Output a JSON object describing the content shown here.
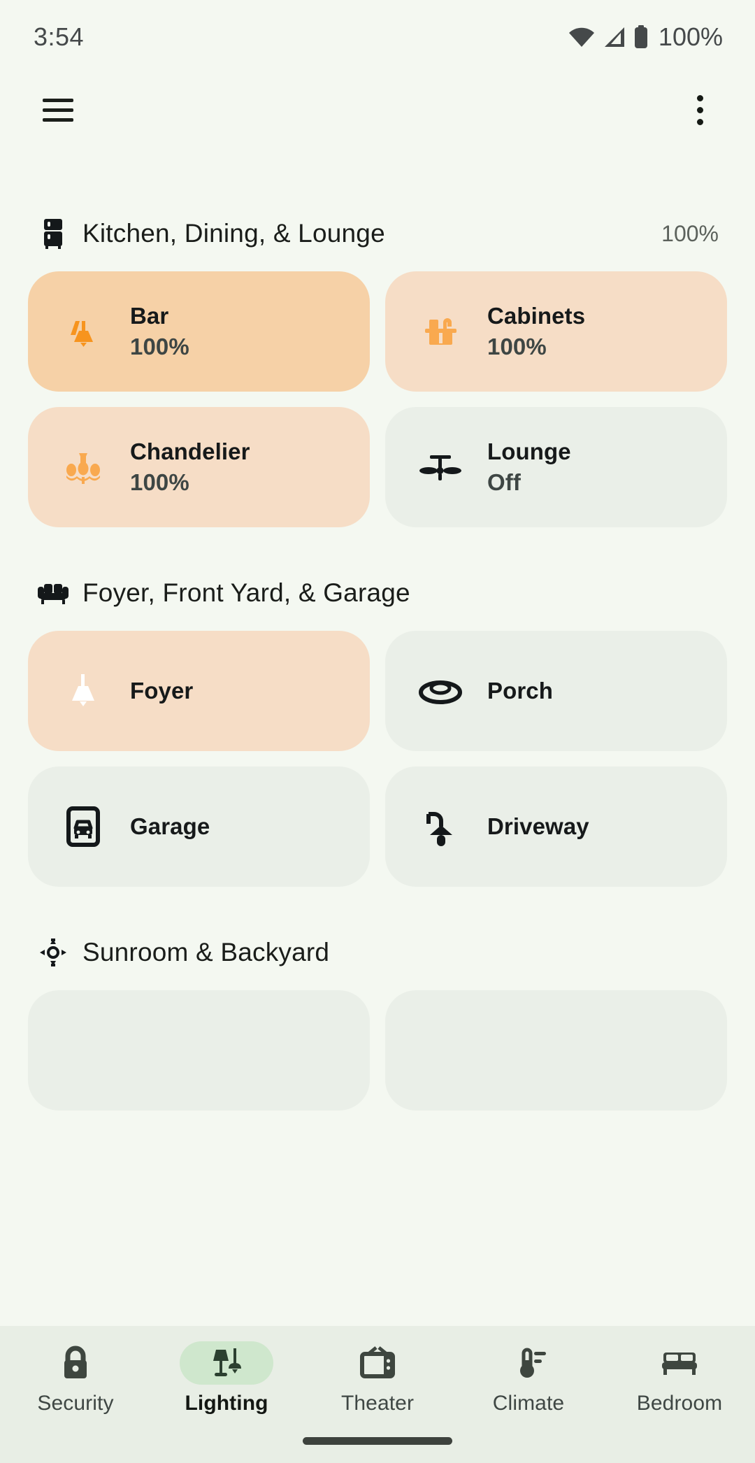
{
  "status_bar": {
    "time": "3:54",
    "battery_percent": "100%",
    "icons": [
      "wifi-icon",
      "cellular-signal-icon",
      "battery-icon"
    ]
  },
  "app_bar": {
    "menu_label": "menu-icon",
    "overflow_label": "more-options-icon"
  },
  "sections": [
    {
      "id": "kitchen-dining-lounge",
      "icon": "refrigerator-icon",
      "title": "Kitchen, Dining, & Lounge",
      "percent": "100%",
      "tiles": [
        {
          "name": "Bar",
          "state": "100%",
          "icon": "wall-lamp-icon",
          "status": "on-strong"
        },
        {
          "name": "Cabinets",
          "state": "100%",
          "icon": "kitchen-sink-icon",
          "status": "on-soft"
        },
        {
          "name": "Chandelier",
          "state": "100%",
          "icon": "chandelier-icon",
          "status": "on-soft"
        },
        {
          "name": "Lounge",
          "state": "Off",
          "icon": "ceiling-fan-icon",
          "status": "off"
        }
      ]
    },
    {
      "id": "foyer-front-yard-garage",
      "icon": "sofa-icon",
      "title": "Foyer, Front Yard, & Garage",
      "percent": "",
      "tiles": [
        {
          "name": "Foyer",
          "state": "",
          "icon": "pendant-lamp-icon",
          "status": "on-soft-white"
        },
        {
          "name": "Porch",
          "state": "",
          "icon": "dome-light-icon",
          "status": "off"
        },
        {
          "name": "Garage",
          "state": "",
          "icon": "garage-car-icon",
          "status": "off"
        },
        {
          "name": "Driveway",
          "state": "",
          "icon": "outdoor-lamp-icon",
          "status": "off"
        }
      ]
    },
    {
      "id": "sunroom-backyard",
      "icon": "sun-brightness-icon",
      "title": "Sunroom & Backyard",
      "percent": "",
      "tiles": [
        {
          "name": "",
          "state": "",
          "icon": "",
          "status": "off"
        },
        {
          "name": "",
          "state": "",
          "icon": "",
          "status": "off"
        }
      ]
    }
  ],
  "bottom_nav": {
    "active": "Lighting",
    "items": [
      {
        "label": "Security",
        "icon": "lock-icon"
      },
      {
        "label": "Lighting",
        "icon": "lamp-icon"
      },
      {
        "label": "Theater",
        "icon": "tv-icon"
      },
      {
        "label": "Climate",
        "icon": "thermometer-icon"
      },
      {
        "label": "Bedroom",
        "icon": "bed-icon"
      }
    ]
  },
  "colors": {
    "background": "#f4f8f1",
    "tile_on_strong": "#f6d1a7",
    "tile_on_soft": "#f6ddc6",
    "tile_off": "#eaefe8",
    "accent_orange": "#f7941e",
    "accent_orange_soft": "#f9a94f",
    "nav_background": "#e8eee5",
    "nav_active_pill": "#cfe7cd"
  }
}
